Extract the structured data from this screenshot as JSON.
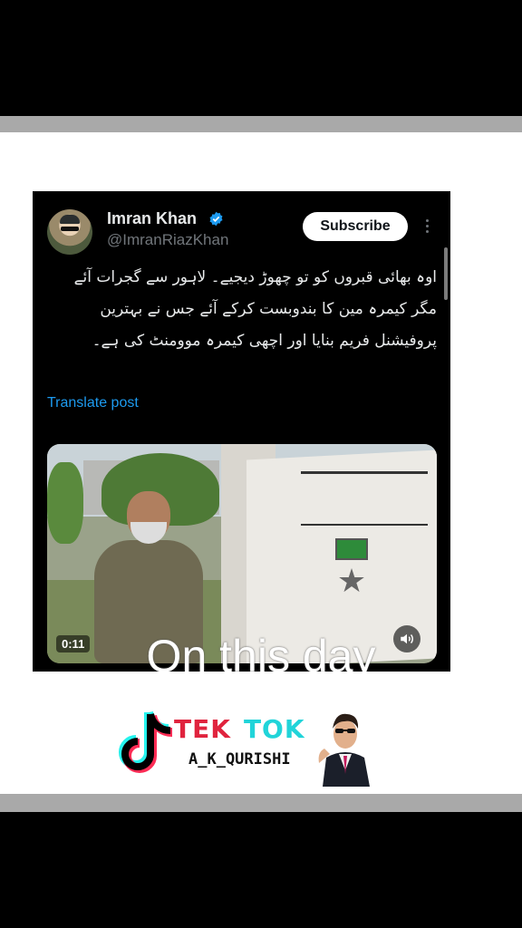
{
  "post": {
    "author_name": "Imran Khan",
    "author_handle": "@ImranRiazKhan",
    "subscribe_label": "Subscribe",
    "text": "اوہ بھائی قبروں کو تو چھوڑ دیجیے۔ لاہور سے گجرات آئے مگر کیمرہ مین کا بندوبست کرکے آئے جس نے بہترین پروفیشنل فریم بنایا اور اچھی کیمرہ موومنٹ کی ہے۔",
    "translate_label": "Translate post",
    "video_duration": "0:11"
  },
  "overlay": {
    "text": "On this day"
  },
  "watermark": {
    "brand_tek": "TEK",
    "brand_tok": "TOK",
    "account": "A_K_QURISHI"
  },
  "colors": {
    "link": "#1d9bf0",
    "verified": "#1d9bf0",
    "tek": "#e0243e",
    "tok": "#21d4d9"
  },
  "icons": [
    "verified-badge-icon",
    "more-options-icon",
    "volume-icon",
    "tiktok-logo-icon"
  ]
}
